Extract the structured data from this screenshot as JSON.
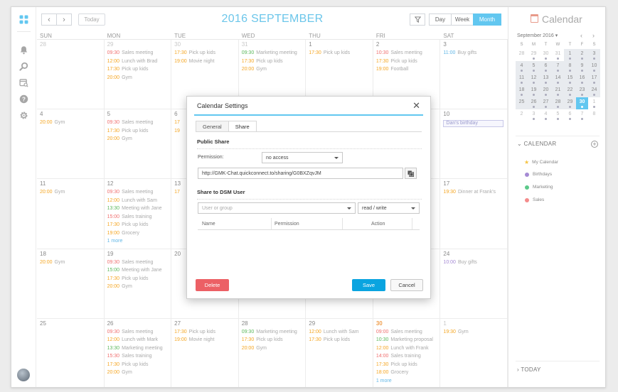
{
  "toolbar": {
    "title": "2016 SEPTEMBER",
    "today_label": "Today",
    "views": [
      "Day",
      "Week",
      "Month"
    ],
    "active_view": "Month",
    "prev_icon": "chevron-left-icon",
    "next_icon": "chevron-right-icon",
    "filter_icon": "filter-icon"
  },
  "colors": {
    "accent": "#62c7f0",
    "orange": "#f5a623",
    "green": "#5cb85c",
    "red": "#f07070",
    "purple": "#a58ad4",
    "salmon": "#f48b8b"
  },
  "weekdays": [
    "SUN",
    "MON",
    "TUE",
    "WED",
    "THU",
    "FRI",
    "SAT"
  ],
  "weeks": [
    [
      {
        "day": "28",
        "other": true,
        "events": []
      },
      {
        "day": "29",
        "other": true,
        "events": [
          {
            "time": "09:30",
            "text": "Sales meeting",
            "color": "#f07070"
          },
          {
            "time": "12:00",
            "text": "Lunch with Brad",
            "color": "#f5a623"
          },
          {
            "time": "17:30",
            "text": "Pick up kids",
            "color": "#f5a623"
          },
          {
            "time": "20:00",
            "text": "Gym",
            "color": "#f5a623"
          }
        ]
      },
      {
        "day": "30",
        "other": true,
        "events": [
          {
            "time": "17:30",
            "text": "Pick up kids",
            "color": "#f5a623"
          },
          {
            "time": "19:00",
            "text": "Movie night",
            "color": "#f5a623"
          }
        ]
      },
      {
        "day": "31",
        "other": true,
        "events": [
          {
            "time": "09:30",
            "text": "Marketing meeting",
            "color": "#5cb85c"
          },
          {
            "time": "17:30",
            "text": "Pick up kids",
            "color": "#f5a623"
          },
          {
            "time": "20:00",
            "text": "Gym",
            "color": "#f5a623"
          }
        ]
      },
      {
        "day": "1",
        "events": [
          {
            "time": "17:30",
            "text": "Pick up kids",
            "color": "#f5a623"
          }
        ]
      },
      {
        "day": "2",
        "events": [
          {
            "time": "10:30",
            "text": "Sales meeting",
            "color": "#f07070"
          },
          {
            "time": "17:30",
            "text": "Pick up kids",
            "color": "#f5a623"
          },
          {
            "time": "19:00",
            "text": "Football",
            "color": "#f5a623"
          }
        ]
      },
      {
        "day": "3",
        "events": [
          {
            "time": "11:00",
            "text": "Buy gifts",
            "color": "#62b7e6"
          }
        ]
      }
    ],
    [
      {
        "day": "4",
        "events": [
          {
            "time": "20:00",
            "text": "Gym",
            "color": "#f5a623"
          }
        ]
      },
      {
        "day": "5",
        "events": [
          {
            "time": "09:30",
            "text": "Sales meeting",
            "color": "#f07070"
          },
          {
            "time": "17:30",
            "text": "Pick up kids",
            "color": "#f5a623"
          },
          {
            "time": "20:00",
            "text": "Gym",
            "color": "#f5a623"
          }
        ]
      },
      {
        "day": "6",
        "events": [
          {
            "time": "17",
            "text": "",
            "color": "#f5a623"
          },
          {
            "time": "19",
            "text": "",
            "color": "#f5a623"
          }
        ]
      },
      {
        "day": "",
        "events": []
      },
      {
        "day": "",
        "events": []
      },
      {
        "day": "",
        "events": []
      },
      {
        "day": "10",
        "allday": "Dan's birthday",
        "events": []
      }
    ],
    [
      {
        "day": "11",
        "events": [
          {
            "time": "20:00",
            "text": "Gym",
            "color": "#f5a623"
          }
        ]
      },
      {
        "day": "12",
        "events": [
          {
            "time": "09:30",
            "text": "Sales meeting",
            "color": "#f07070"
          },
          {
            "time": "12:00",
            "text": "Lunch with Sam",
            "color": "#f5a623"
          },
          {
            "time": "13:30",
            "text": "Meeting with Jane",
            "color": "#5cb85c"
          },
          {
            "time": "15:00",
            "text": "Sales training",
            "color": "#f07070"
          },
          {
            "time": "17:30",
            "text": "Pick up kids",
            "color": "#f5a623"
          },
          {
            "time": "19:00",
            "text": "Grocery",
            "color": "#f5a623"
          }
        ],
        "more": "1 more"
      },
      {
        "day": "13",
        "events": [
          {
            "time": "17",
            "text": "",
            "color": "#f5a623"
          }
        ]
      },
      {
        "day": "",
        "events": []
      },
      {
        "day": "",
        "events": []
      },
      {
        "day": "",
        "events": []
      },
      {
        "day": "17",
        "events": [
          {
            "time": "19:30",
            "text": "Dinner at Frank's",
            "color": "#f5a623"
          }
        ]
      }
    ],
    [
      {
        "day": "18",
        "events": [
          {
            "time": "20:00",
            "text": "Gym",
            "color": "#f5a623"
          }
        ]
      },
      {
        "day": "19",
        "events": [
          {
            "time": "09:30",
            "text": "Sales meeting",
            "color": "#f07070"
          },
          {
            "time": "15:00",
            "text": "Meeting with Jane",
            "color": "#5cb85c"
          },
          {
            "time": "17:30",
            "text": "Pick up kids",
            "color": "#f5a623"
          },
          {
            "time": "20:00",
            "text": "Gym",
            "color": "#f5a623"
          }
        ]
      },
      {
        "day": "20",
        "events": []
      },
      {
        "day": "",
        "events": []
      },
      {
        "day": "",
        "events": []
      },
      {
        "day": "",
        "events": []
      },
      {
        "day": "24",
        "events": [
          {
            "time": "10:00",
            "text": "Buy gifts",
            "color": "#a58ad4"
          }
        ]
      }
    ],
    [
      {
        "day": "25",
        "events": []
      },
      {
        "day": "26",
        "events": [
          {
            "time": "09:30",
            "text": "Sales meeting",
            "color": "#f07070"
          },
          {
            "time": "12:00",
            "text": "Lunch with Mark",
            "color": "#f5a623"
          },
          {
            "time": "13:30",
            "text": "Marketing meeting",
            "color": "#5cb85c"
          },
          {
            "time": "15:30",
            "text": "Sales training",
            "color": "#f07070"
          },
          {
            "time": "17:30",
            "text": "Pick up kids",
            "color": "#f5a623"
          },
          {
            "time": "20:00",
            "text": "Gym",
            "color": "#f5a623"
          }
        ]
      },
      {
        "day": "27",
        "events": [
          {
            "time": "17:30",
            "text": "Pick up kids",
            "color": "#f5a623"
          },
          {
            "time": "19:00",
            "text": "Movie night",
            "color": "#f5a623"
          }
        ]
      },
      {
        "day": "28",
        "events": [
          {
            "time": "09:30",
            "text": "Marketing meeting",
            "color": "#5cb85c"
          },
          {
            "time": "17:30",
            "text": "Pick up kids",
            "color": "#f5a623"
          },
          {
            "time": "20:00",
            "text": "Gym",
            "color": "#f5a623"
          }
        ]
      },
      {
        "day": "29",
        "events": [
          {
            "time": "12:00",
            "text": "Lunch with Sam",
            "color": "#f5a623"
          },
          {
            "time": "17:30",
            "text": "Pick up kids",
            "color": "#f5a623"
          }
        ]
      },
      {
        "day": "30",
        "today": true,
        "events": [
          {
            "time": "09:00",
            "text": "Sales meeting",
            "color": "#f07070"
          },
          {
            "time": "10:30",
            "text": "Marketing proposal",
            "color": "#5cb85c"
          },
          {
            "time": "12:00",
            "text": "Lunch with Frank",
            "color": "#f5a623"
          },
          {
            "time": "14:00",
            "text": "Sales training",
            "color": "#f07070"
          },
          {
            "time": "17:30",
            "text": "Pick up kids",
            "color": "#f5a623"
          },
          {
            "time": "18:00",
            "text": "Grocery",
            "color": "#f5a623"
          }
        ],
        "more": "1 more"
      },
      {
        "day": "1",
        "other": true,
        "events": [
          {
            "time": "19:30",
            "text": "Gym",
            "color": "#f5a623"
          }
        ]
      }
    ]
  ],
  "right_panel": {
    "title": "Calendar",
    "mini_month": "September 2016",
    "mini_headers": [
      "S",
      "M",
      "T",
      "W",
      "T",
      "F",
      "S"
    ],
    "mini_weeks": [
      [
        {
          "d": "28",
          "o": true
        },
        {
          "d": "29",
          "o": true,
          "dot": true
        },
        {
          "d": "30",
          "o": true,
          "dot": true
        },
        {
          "d": "31",
          "o": true,
          "dot": true
        },
        {
          "d": "1",
          "dot": true
        },
        {
          "d": "2",
          "dot": true
        },
        {
          "d": "3",
          "dot": true
        }
      ],
      [
        {
          "d": "4",
          "dot": true
        },
        {
          "d": "5",
          "dot": true
        },
        {
          "d": "6",
          "dot": true
        },
        {
          "d": "7",
          "dot": true
        },
        {
          "d": "8",
          "dot": true
        },
        {
          "d": "9",
          "dot": true
        },
        {
          "d": "10",
          "dot": true
        }
      ],
      [
        {
          "d": "11",
          "dot": true
        },
        {
          "d": "12",
          "dot": true
        },
        {
          "d": "13",
          "dot": true
        },
        {
          "d": "14",
          "dot": true
        },
        {
          "d": "15",
          "dot": true
        },
        {
          "d": "16",
          "dot": true
        },
        {
          "d": "17",
          "dot": true
        }
      ],
      [
        {
          "d": "18",
          "dot": true
        },
        {
          "d": "19",
          "dot": true
        },
        {
          "d": "20",
          "dot": true
        },
        {
          "d": "21",
          "dot": true
        },
        {
          "d": "22",
          "dot": true
        },
        {
          "d": "23",
          "dot": true
        },
        {
          "d": "24",
          "dot": true
        }
      ],
      [
        {
          "d": "25"
        },
        {
          "d": "26",
          "dot": true
        },
        {
          "d": "27",
          "dot": true
        },
        {
          "d": "28",
          "dot": true
        },
        {
          "d": "29",
          "dot": true
        },
        {
          "d": "30",
          "sel": true,
          "dot": true
        },
        {
          "d": "1",
          "o": true,
          "dot": true
        }
      ],
      [
        {
          "d": "2",
          "o": true
        },
        {
          "d": "3",
          "o": true,
          "dot": true
        },
        {
          "d": "4",
          "o": true,
          "dot": true
        },
        {
          "d": "5",
          "o": true,
          "dot": true
        },
        {
          "d": "6",
          "o": true,
          "dot": true
        },
        {
          "d": "7",
          "o": true,
          "dot": true
        },
        {
          "d": "8",
          "o": true
        }
      ]
    ],
    "calendar_section": "CALENDAR",
    "calendars": [
      {
        "name": "My Calendar",
        "color": "#f5c342",
        "star": true
      },
      {
        "name": "Birthdays",
        "color": "#a58ad4"
      },
      {
        "name": "Marketing",
        "color": "#5cc98a"
      },
      {
        "name": "Sales",
        "color": "#f48b8b"
      }
    ],
    "today_section": "TODAY"
  },
  "modal": {
    "title": "Calendar Settings",
    "tabs": [
      "General",
      "Share"
    ],
    "active_tab": "Share",
    "public_share": "Public Share",
    "permission_label": "Permission:",
    "permission_value": "no access",
    "share_url": "http://GMK-Chat.quickconnect.to/sharing/G0BXZqvJM",
    "dsm_heading": "Share to DSM User",
    "user_placeholder": "User or group",
    "access_value": "read / write",
    "columns": [
      "Name",
      "Permission",
      "Action"
    ],
    "delete_label": "Delete",
    "save_label": "Save",
    "cancel_label": "Cancel"
  }
}
